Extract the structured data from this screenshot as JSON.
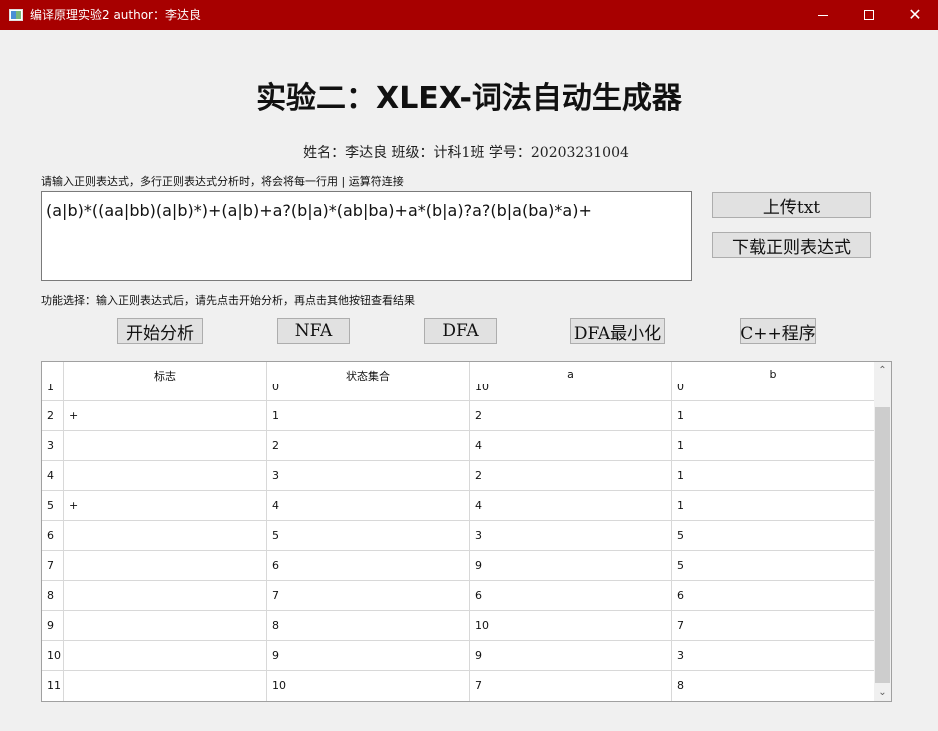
{
  "window": {
    "title": "编译原理实验2  author：李达良",
    "minimize": "—",
    "maximize": "☐",
    "close": "✕"
  },
  "header": {
    "title": "实验二：XLEX-词法自动生成器",
    "student_info": "姓名：李达良 班级：计科1班 学号：20203231004"
  },
  "input": {
    "label": "请输入正则表达式，多行正则表达式分析时，将会将每一行用 | 运算符连接",
    "value": "(a|b)*((aa|bb)(a|b)*)+(a|b)+a?(b|a)*(ab|ba)+a*(b|a)?a?(b|a(ba)*a)+",
    "upload_button": "上传txt",
    "download_button": "下载正则表达式"
  },
  "functions": {
    "label": "功能选择：输入正则表达式后，请先点击开始分析，再点击其他按钮查看结果",
    "buttons": {
      "start": "开始分析",
      "nfa": "NFA",
      "dfa": "DFA",
      "dfa_min": "DFA最小化",
      "cpp": "C++程序"
    }
  },
  "table": {
    "headers": [
      "标志",
      "状态集合",
      "a",
      "b"
    ],
    "partial_row": {
      "num": "1",
      "flag": "",
      "state": "0",
      "a": "10",
      "b": "0"
    },
    "rows": [
      {
        "num": "2",
        "flag": "+",
        "state": "1",
        "a": "2",
        "b": "1"
      },
      {
        "num": "3",
        "flag": "",
        "state": "2",
        "a": "4",
        "b": "1"
      },
      {
        "num": "4",
        "flag": "",
        "state": "3",
        "a": "2",
        "b": "1"
      },
      {
        "num": "5",
        "flag": "+",
        "state": "4",
        "a": "4",
        "b": "1"
      },
      {
        "num": "6",
        "flag": "",
        "state": "5",
        "a": "3",
        "b": "5"
      },
      {
        "num": "7",
        "flag": "",
        "state": "6",
        "a": "9",
        "b": "5"
      },
      {
        "num": "8",
        "flag": "",
        "state": "7",
        "a": "6",
        "b": "6"
      },
      {
        "num": "9",
        "flag": "",
        "state": "8",
        "a": "10",
        "b": "7"
      },
      {
        "num": "10",
        "flag": "",
        "state": "9",
        "a": "9",
        "b": "3"
      },
      {
        "num": "11",
        "flag": "",
        "state": "10",
        "a": "7",
        "b": "8"
      }
    ],
    "scroll_up": "⌃",
    "scroll_down": "⌄"
  }
}
